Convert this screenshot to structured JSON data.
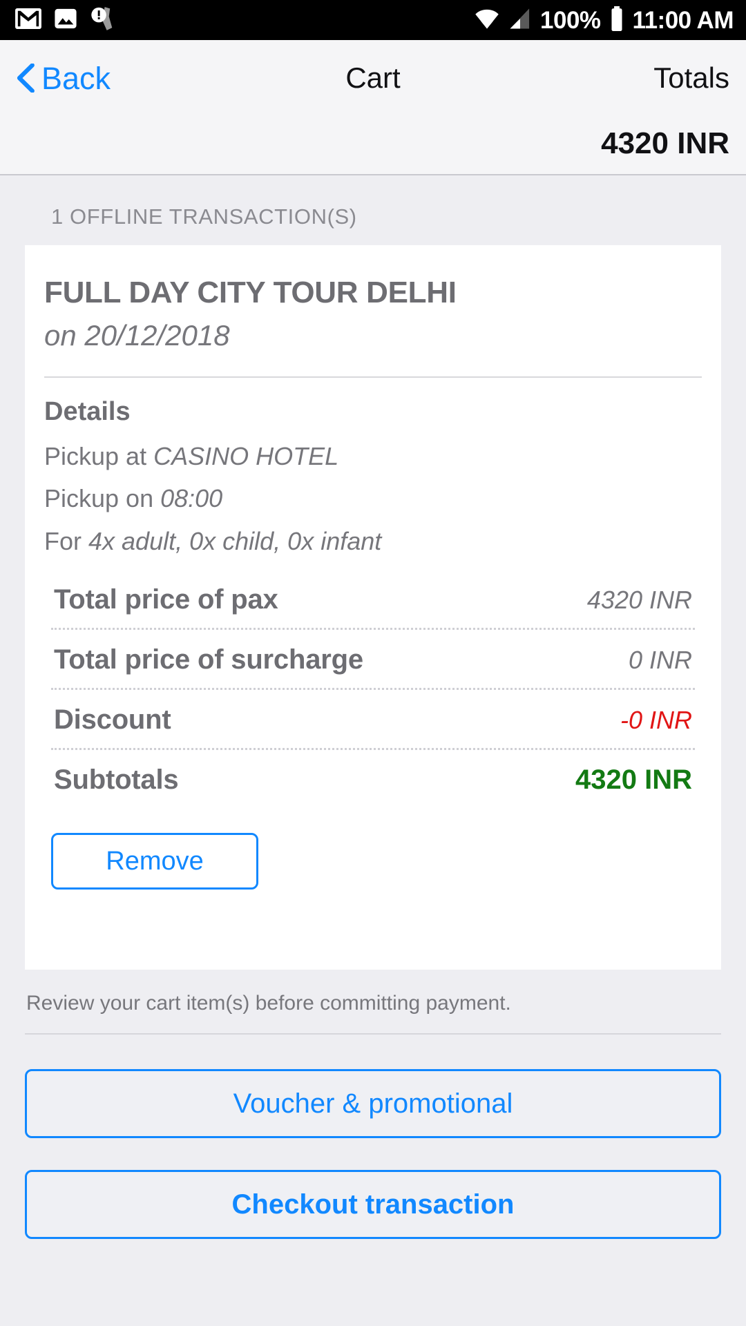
{
  "status_bar": {
    "icons_left": [
      "gmail-icon",
      "image-icon",
      "warning-icon"
    ],
    "wifi_icon": "wifi-icon",
    "signal_icon": "signal-icon",
    "battery_percent": "100%",
    "battery_icon": "battery-full-icon",
    "clock": "11:00 AM"
  },
  "nav": {
    "back_label": "Back",
    "back_icon": "chevron-left-icon",
    "title": "Cart",
    "totals_label": "Totals",
    "totals_value": "4320 INR"
  },
  "main": {
    "section_label": "1 OFFLINE TRANSACTION(S)",
    "card": {
      "title": "FULL DAY CITY TOUR DELHI",
      "date": "on 20/12/2018",
      "details_heading": "Details",
      "detail_lines": [
        {
          "label": "Pickup at ",
          "value": "CASINO HOTEL"
        },
        {
          "label": "Pickup on ",
          "value": "08:00"
        },
        {
          "label": "For ",
          "value": "4x adult, 0x child, 0x infant"
        }
      ],
      "price_rows": [
        {
          "name": "Total price of pax",
          "value": "4320 INR",
          "style": "normal"
        },
        {
          "name": "Total price of surcharge",
          "value": "0 INR",
          "style": "normal"
        },
        {
          "name": "Discount",
          "value": "-0 INR",
          "style": "neg"
        },
        {
          "name": "Subtotals",
          "value": "4320 INR",
          "style": "pos"
        }
      ],
      "remove_label": "Remove"
    }
  },
  "footer": {
    "note": "Review your cart item(s) before committing payment.",
    "voucher_label": "Voucher & promotional",
    "checkout_label": "Checkout transaction"
  },
  "colors": {
    "accent_blue": "#1188ff",
    "discount_red": "#e11515",
    "subtotal_green": "#137a13",
    "page_bg": "#eeeef2",
    "card_bg": "#ffffff",
    "nav_bg": "#f5f5f7",
    "muted_text": "#76767b"
  }
}
